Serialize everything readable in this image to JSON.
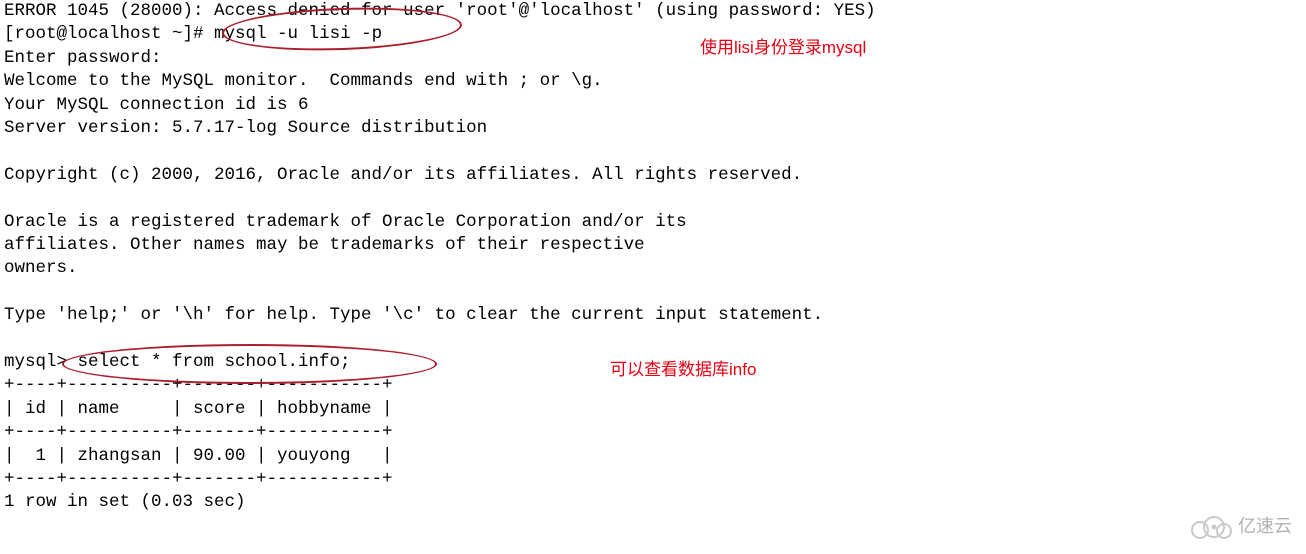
{
  "terminal": {
    "line0": "ERROR 1045 (28000): Access denied for user 'root'@'localhost' (using password: YES)",
    "prompt1": "[root@localhost ~]# ",
    "cmd1": "mysql -u lisi -p",
    "line2": "Enter password:",
    "line3": "Welcome to the MySQL monitor.  Commands end with ; or \\g.",
    "line4": "Your MySQL connection id is 6",
    "line5": "Server version: 5.7.17-log Source distribution",
    "line6": "Copyright (c) 2000, 2016, Oracle and/or its affiliates. All rights reserved.",
    "line7": "Oracle is a registered trademark of Oracle Corporation and/or its",
    "line8": "affiliates. Other names may be trademarks of their respective",
    "line9": "owners.",
    "line10": "Type 'help;' or '\\h' for help. Type '\\c' to clear the current input statement.",
    "prompt2": "mysql> ",
    "cmd2": "select * from school.info;",
    "table": {
      "border": "+----+----------+-------+-----------+",
      "header": "| id | name     | score | hobbyname |",
      "row1": "|  1 | zhangsan | 90.00 | youyong   |",
      "columns": [
        "id",
        "name",
        "score",
        "hobbyname"
      ],
      "rows": [
        {
          "id": 1,
          "name": "zhangsan",
          "score": "90.00",
          "hobbyname": "youyong"
        }
      ]
    },
    "footer": "1 row in set (0.03 sec)"
  },
  "annotations": {
    "a1": "使用lisi身份登录mysql",
    "a2": "可以查看数据库info"
  },
  "watermark": {
    "text": "亿速云"
  }
}
